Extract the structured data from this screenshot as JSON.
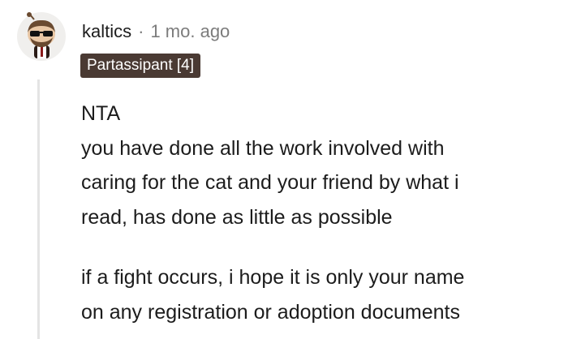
{
  "comment": {
    "author": "kaltics",
    "separator": "·",
    "timestamp": "1 mo. ago",
    "flair": "Partassipant [4]",
    "paragraphs": [
      [
        "NTA",
        "you have done all the work involved with",
        "caring for the cat and your friend by what i",
        "read, has done as little as possible"
      ],
      [
        "if a fight occurs, i hope it is only your name",
        "on any registration or adoption documents"
      ]
    ]
  },
  "colors": {
    "flair_background": "#4a3a33",
    "meta_text": "#7c7c7c",
    "thread_line": "#e4e4e4"
  },
  "icons": {
    "avatar": "snoo-avatar-sunglasses"
  }
}
